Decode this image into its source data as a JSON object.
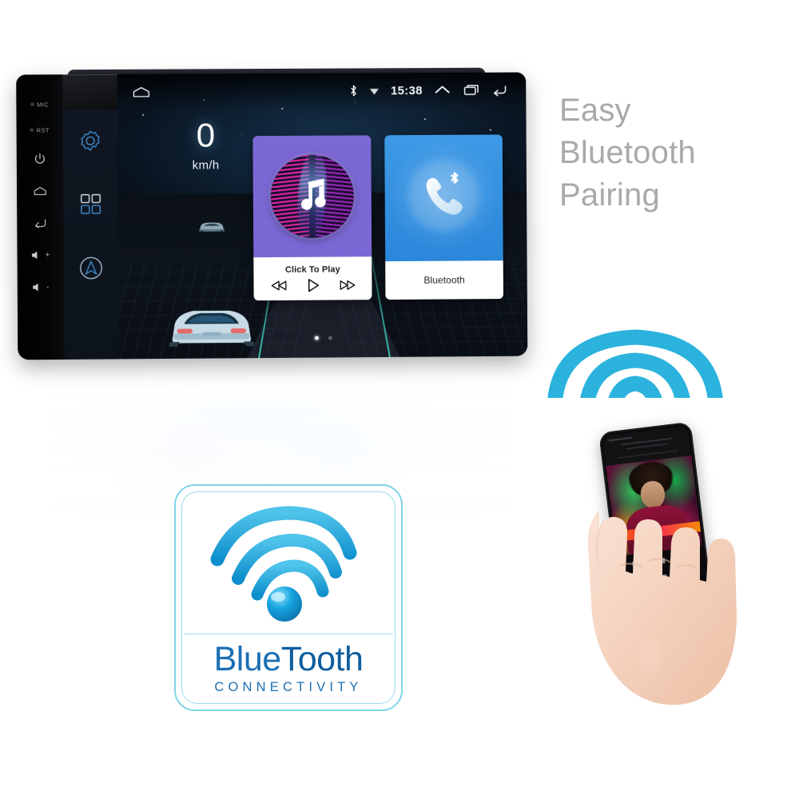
{
  "headline": {
    "line1": "Easy",
    "line2": "Bluetooth",
    "line3": "Pairing"
  },
  "head_unit": {
    "hard_keys": [
      {
        "name": "mic-indicator",
        "label": "MIC"
      },
      {
        "name": "reset-indicator",
        "label": "RST"
      },
      {
        "name": "power-key",
        "label": ""
      },
      {
        "name": "home-key",
        "label": ""
      },
      {
        "name": "back-key",
        "label": ""
      },
      {
        "name": "volume-up-key",
        "label": "+"
      },
      {
        "name": "volume-down-key",
        "label": "-"
      }
    ],
    "status_bar": {
      "bluetooth_icon": "bluetooth-icon",
      "wifi_icon": "wifi-icon",
      "clock": "15:38",
      "expand_icon": "chevron-up-icon",
      "recents_icon": "recents-icon",
      "back_icon": "back-arrow-icon",
      "home_icon": "home-icon"
    },
    "sidebar": [
      {
        "name": "settings-icon",
        "label": "Settings"
      },
      {
        "name": "apps-grid-icon",
        "label": "Apps"
      },
      {
        "name": "navigation-icon",
        "label": "Navigation"
      }
    ],
    "speedometer": {
      "value": "0",
      "unit": "km/h"
    },
    "cards": [
      {
        "id": "music",
        "name": "music-card",
        "title": "Click To Play",
        "accent": "#7b68d4",
        "controls": [
          "previous-track-button",
          "play-button",
          "next-track-button"
        ]
      },
      {
        "id": "bluetooth",
        "name": "bluetooth-card",
        "title": "Bluetooth",
        "accent": "#2e8fe0",
        "icon": "bluetooth-phone-icon"
      }
    ],
    "page_dots": {
      "count": 2,
      "active": 1
    }
  },
  "badge": {
    "title_part1": "Blue",
    "title_part2": "Tooth",
    "subtitle": "CONNECTIVITY",
    "icon": "bluetooth-signal-icon",
    "color": "#1b6fb5",
    "border_color": "#7fd3e8"
  },
  "signal_waves": {
    "name": "wireless-signal-icon",
    "color": "#2bb3dd",
    "arc_count": 3
  },
  "phone": {
    "name": "smartphone-in-hand",
    "screen": "music-player-album-art"
  },
  "colors": {
    "background": "#ffffff",
    "headline_text": "#a8a9ab",
    "cyan": "#2bb3dd",
    "purple": "#7b68d4",
    "blue": "#2e8fe0"
  }
}
